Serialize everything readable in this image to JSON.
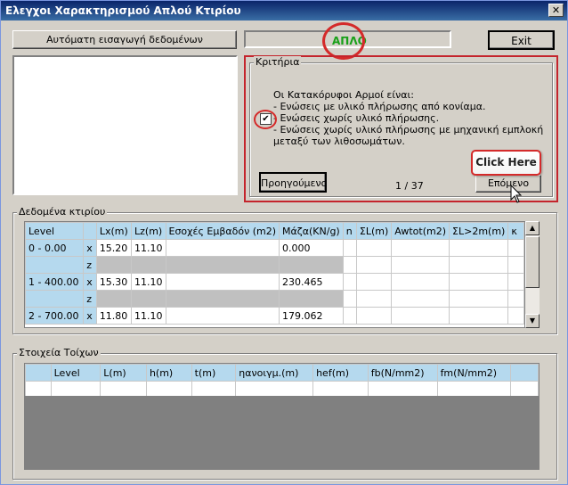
{
  "window": {
    "title": "Ελεγχοι Χαρακτηρισμού Απλού Κτιρίου",
    "close_glyph": "✕"
  },
  "toolbar": {
    "auto_input_label": "Αυτόματη εισαγωγή δεδομένων",
    "exit_label": "Exit",
    "status_text": "ΑΠΛΟ"
  },
  "criteria": {
    "group_label": "Κριτήρια",
    "heading": "Οι Κατακόρυφοι Αρμοί είναι:",
    "options": [
      "- Ενώσεις με υλικό πλήρωσης από κονίαμα.",
      "- Ενώσεις χωρίς υλικό πλήρωσης.",
      "- Ενώσεις χωρίς υλικό πλήρωσης με μηχανική εμπλοκή μεταξύ των λιθοσωμάτων."
    ],
    "checkbox_mark": "✔",
    "prev_label": "Προηγούμενο",
    "next_label": "Επόμενο",
    "page_counter": "1 / 37",
    "tooltip": "Click Here"
  },
  "building": {
    "group_label": "Δεδομένα κτιρίου",
    "columns": [
      "Level",
      "",
      "Lx(m)",
      "Lz(m)",
      "Εσοχές Εμβαδόν (m2)",
      "Μάζα(KN/g)",
      "n",
      "ΣL(m)",
      "Awtot(m2)",
      "ΣL>2m(m)",
      "κ"
    ],
    "rows": [
      {
        "level": "0 - 0.00",
        "axis": "x",
        "lx": "15.20",
        "lz": "11.10",
        "mass": "0.000"
      },
      {
        "level": "",
        "axis": "z",
        "lx": "",
        "lz": "",
        "mass": ""
      },
      {
        "level": "1 - 400.00",
        "axis": "x",
        "lx": "15.30",
        "lz": "11.10",
        "mass": "230.465"
      },
      {
        "level": "",
        "axis": "z",
        "lx": "",
        "lz": "",
        "mass": ""
      },
      {
        "level": "2 - 700.00",
        "axis": "x",
        "lx": "11.80",
        "lz": "11.10",
        "mass": "179.062"
      }
    ],
    "scroll_up": "▲",
    "scroll_down": "▼"
  },
  "walls": {
    "group_label": "Στοιχεία Τοίχων",
    "columns": [
      "",
      "Level",
      "L(m)",
      "h(m)",
      "t(m)",
      "ηανοιγμ.(m)",
      "hef(m)",
      "fb(N/mm2)",
      "fm(N/mm2)",
      ""
    ]
  },
  "colors": {
    "accent_red": "#d42a2a",
    "header_blue": "#b5d9ee",
    "status_green": "#18a018"
  }
}
